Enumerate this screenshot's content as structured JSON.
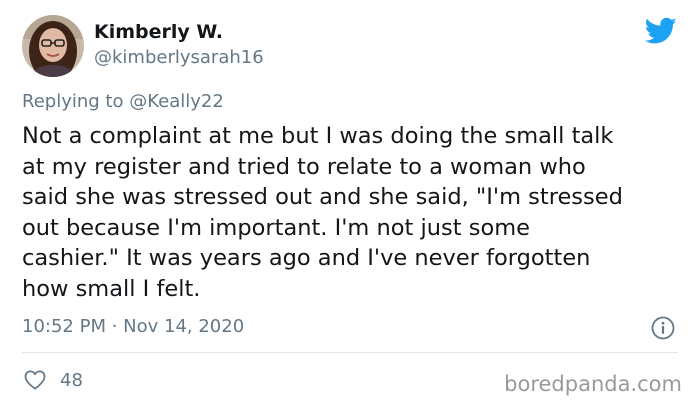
{
  "author": {
    "display_name": "Kimberly W.",
    "handle": "@kimberlysarah16",
    "avatar_icon": "avatar-photo"
  },
  "reply": {
    "prefix": "Replying to",
    "mention": "@Keally22"
  },
  "tweet": {
    "text": "Not a complaint at me but I was doing the small talk\nat my register and tried to relate to a woman who\nsaid she was stressed out and she said, \"I'm stressed\nout because I'm important. I'm not just some\ncashier.\" It was years ago and I've never forgotten\nhow small I felt.",
    "timestamp": "10:52 PM · Nov 14, 2020"
  },
  "engagement": {
    "likes": "48",
    "like_icon": "heart-icon"
  },
  "icons": {
    "brand": "twitter-bird-icon",
    "info": "info-icon"
  },
  "watermark": "boredpanda.com",
  "colors": {
    "twitter_blue": "#1da1f2",
    "text_primary": "#14171a",
    "text_secondary": "#657786",
    "divider": "#e1e8ed"
  }
}
